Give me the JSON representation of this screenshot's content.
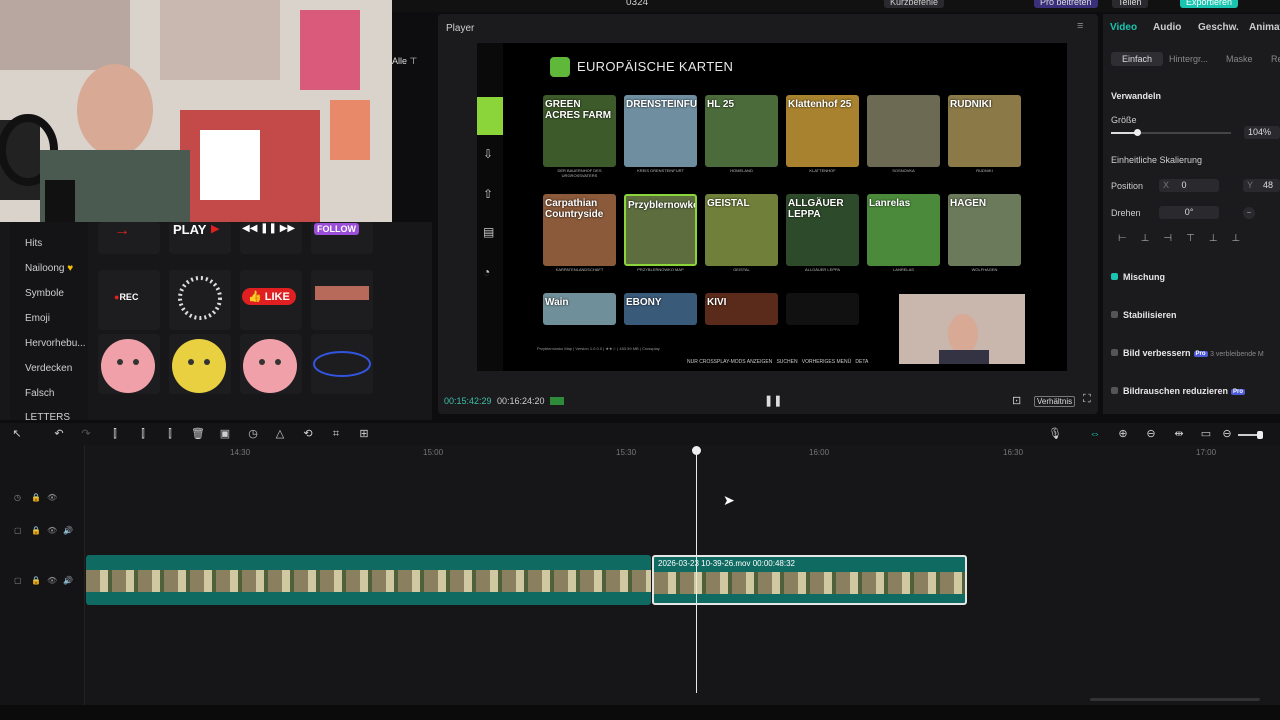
{
  "app": {
    "project_title": "0324",
    "top_buttons": [
      "Teilen",
      "Exportieren"
    ],
    "top_misc": [
      "Kurzbefehle",
      "Pro beitreten"
    ]
  },
  "library": {
    "filter_label": "Alle",
    "categories": [
      "Hits",
      "Nailoong",
      "Symbole",
      "Emoji",
      "Hervorhebu...",
      "Verdecken",
      "Falsch",
      "LETTERS"
    ],
    "stickers": {
      "play": "PLAY",
      "follow": "FOLLOW",
      "rec": "REC",
      "like": "LIKE"
    }
  },
  "player": {
    "title": "Player",
    "time_current": "00:15:42:29",
    "time_total": "00:16:24:20",
    "ratio_button": "Verhältnis",
    "screen": {
      "heading": "EUROPÄISCHE KARTEN",
      "tiles": [
        {
          "name": "GREEN ACRES FARM",
          "label": "DER BAUERNHOF DES URGROSSVATERS",
          "color": "#3d5a2a"
        },
        {
          "name": "DRENSTEINFURT",
          "label": "KREIS DRENSTEINFURT",
          "color": "#6f8fa0"
        },
        {
          "name": "HL 25",
          "label": "HOMELAND",
          "color": "#4b6b3a"
        },
        {
          "name": "Klattenhof 25",
          "label": "KLATTENHOF",
          "color": "#a8822e"
        },
        {
          "name": "",
          "label": "SOSNOVKA",
          "color": "#6c6a52"
        },
        {
          "name": "RUDNIKI",
          "label": "RUDNIKI",
          "color": "#8b7a48"
        },
        {
          "name": "Carpathian Countryside",
          "label": "KARPATENLANDSCHAFT",
          "color": "#8a5a3a"
        },
        {
          "name": "Przyblernowko",
          "label": "PRZYBLERNOWKO MAP",
          "color": "#5d6d3e"
        },
        {
          "name": "GEISTAL",
          "label": "GEISTAL",
          "color": "#70803a"
        },
        {
          "name": "ALLGÄUER LEPPA",
          "label": "ALLGÄUER LEPPA",
          "color": "#2d4a2a"
        },
        {
          "name": "Lanrelas",
          "label": "LANRELAS",
          "color": "#4a8a3a"
        },
        {
          "name": "HAGEN",
          "label": "WOLFHAGEN",
          "color": "#6a7a5a"
        },
        {
          "name": "Wain",
          "label": "",
          "color": "#6f8f9a"
        },
        {
          "name": "EBONY",
          "label": "",
          "color": "#3a5a7a"
        },
        {
          "name": "KIVI",
          "label": "",
          "color": "#5a2a1a"
        },
        {
          "name": "",
          "label": "",
          "color": "#111111"
        }
      ],
      "footer_buttons": [
        "NUR CROSSPLAY-MODS ANZEIGEN",
        "SUCHEN",
        "VORHERIGES MENÜ",
        "DETA"
      ],
      "info_line": "Przyblernowko Map | Version 1.0.0.0 | ★★☆ | 453.59 MB | Crossplay"
    }
  },
  "inspector": {
    "tabs": [
      "Video",
      "Audio",
      "Geschw.",
      "Animat"
    ],
    "subtabs": [
      "Einfach",
      "Hintergr...",
      "Maske",
      "Ret"
    ],
    "transform_heading": "Verwandeln",
    "size_label": "Größe",
    "size_value": "104%",
    "scale_label": "Einheitliche Skalierung",
    "position_label": "Position",
    "pos_x_label": "X",
    "pos_x": "0",
    "pos_y_label": "Y",
    "pos_y": "48",
    "rotate_label": "Drehen",
    "rotate_value": "0°",
    "blend_label": "Mischung",
    "stabilize_label": "Stabilisieren",
    "enhance_label": "Bild verbessern",
    "enhance_extra": "3 verbleibende M",
    "denoise_label": "Bildrauschen reduzieren",
    "pro_badge": "Pro"
  },
  "timeline": {
    "ruler": [
      "14:30",
      "15:00",
      "15:30",
      "16:00",
      "16:30",
      "17:00"
    ],
    "clip2_label": "2026-03-23 10-39-26.mov  00:00:48:32"
  }
}
